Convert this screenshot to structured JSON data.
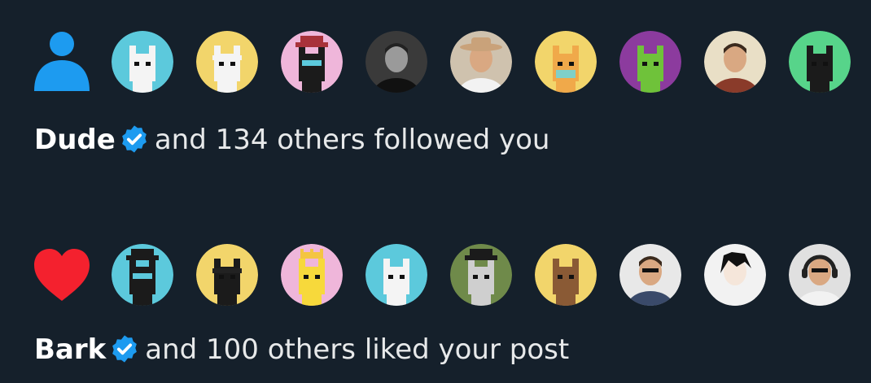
{
  "colors": {
    "background": "#15202b",
    "follow_icon": "#1d9bf0",
    "like_icon": "#f91880",
    "verified": "#1d9bf0"
  },
  "follow": {
    "icon": "person-icon",
    "name": "Dude",
    "verified": true,
    "text": "and 134 others followed you",
    "avatars": [
      {
        "bg": "#5cc9dc",
        "kind": "pixel-cat-white"
      },
      {
        "bg": "#f2d56b",
        "kind": "pixel-cat-bandana"
      },
      {
        "bg": "#efb6da",
        "kind": "pixel-cat-red-hat"
      },
      {
        "bg": "#3a3a3a",
        "kind": "photo-man-bw"
      },
      {
        "bg": "#cfc2ae",
        "kind": "photo-man-cowboy-hat"
      },
      {
        "bg": "#f2d56b",
        "kind": "pixel-doge-mask"
      },
      {
        "bg": "#8c3b9e",
        "kind": "pixel-ape-green"
      },
      {
        "bg": "#e9dfc6",
        "kind": "illustrated-man"
      },
      {
        "bg": "#57d48a",
        "kind": "pixel-cat-black"
      }
    ]
  },
  "like": {
    "icon": "heart-icon",
    "name": "Bark",
    "verified": true,
    "text": "and 100 others liked your post",
    "avatars": [
      {
        "bg": "#5cc9dc",
        "kind": "pixel-cat-black-hat"
      },
      {
        "bg": "#f2d56b",
        "kind": "pixel-cat-ninja"
      },
      {
        "bg": "#efb6da",
        "kind": "pixel-yellow-crown"
      },
      {
        "bg": "#5cc9dc",
        "kind": "pixel-cat-white"
      },
      {
        "bg": "#6f8a4a",
        "kind": "pixel-horse-hat"
      },
      {
        "bg": "#f2d56b",
        "kind": "pixel-bear"
      },
      {
        "bg": "#e8e8e8",
        "kind": "photo-man-suit"
      },
      {
        "bg": "#f2f2f2",
        "kind": "anime-boy"
      },
      {
        "bg": "#e0e0e0",
        "kind": "photo-man-headphones"
      }
    ]
  }
}
